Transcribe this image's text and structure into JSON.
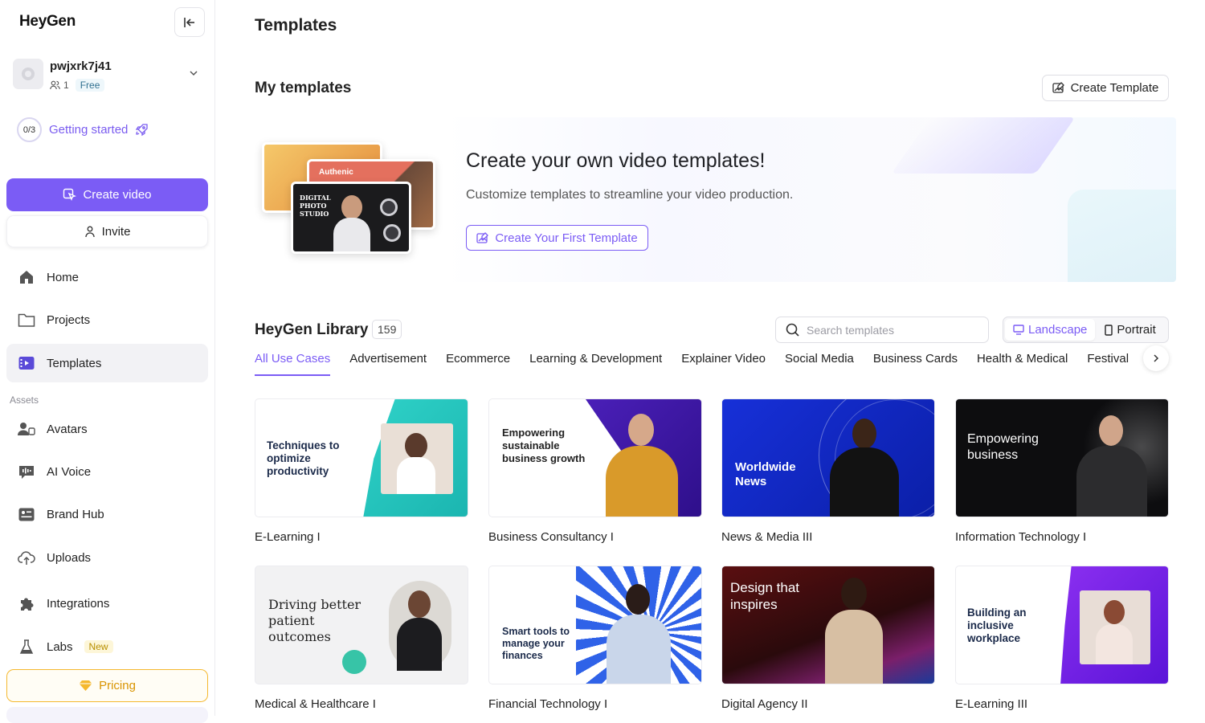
{
  "app": {
    "logo": "HeyGen"
  },
  "sidebar": {
    "account": {
      "name": "pwjxrk7j41",
      "members": "1",
      "plan": "Free"
    },
    "getting_started": {
      "progress": "0/3",
      "label": "Getting started"
    },
    "create_video": "Create video",
    "invite": "Invite",
    "nav": [
      {
        "label": "Home",
        "icon": "home-icon"
      },
      {
        "label": "Projects",
        "icon": "folder-icon"
      },
      {
        "label": "Templates",
        "icon": "templates-icon",
        "active": true
      }
    ],
    "assets_label": "Assets",
    "assets": [
      {
        "label": "Avatars",
        "icon": "avatar-icon"
      },
      {
        "label": "AI Voice",
        "icon": "voice-icon"
      },
      {
        "label": "Brand Hub",
        "icon": "brand-icon"
      },
      {
        "label": "Uploads",
        "icon": "upload-icon"
      },
      {
        "label": "Integrations",
        "icon": "puzzle-icon"
      },
      {
        "label": "Labs",
        "icon": "flask-icon",
        "badge": "New"
      }
    ],
    "pricing": "Pricing"
  },
  "main": {
    "title": "Templates",
    "my_templates": {
      "title": "My templates",
      "create_button": "Create Template",
      "banner": {
        "title": "Create your own video templates!",
        "subtitle": "Customize templates to streamline your video production.",
        "button": "Create Your First Template",
        "card_b_label": "Authenic",
        "card_c_label": "DIGITAL PHOTO STUDIO"
      }
    },
    "library": {
      "title": "HeyGen Library",
      "count": "159",
      "search_placeholder": "Search templates",
      "orientation": {
        "landscape": "Landscape",
        "portrait": "Portrait",
        "selected": "Landscape"
      },
      "tabs": [
        "All Use Cases",
        "Advertisement",
        "Ecommerce",
        "Learning & Development",
        "Explainer Video",
        "Social Media",
        "Business Cards",
        "Health & Medical",
        "Festival"
      ],
      "active_tab": "All Use Cases",
      "templates": [
        {
          "name": "E-Learning I",
          "thumb_text": "Techniques to optimize productivity"
        },
        {
          "name": "Business Consultancy I",
          "thumb_text": "Empowering sustainable business growth"
        },
        {
          "name": "News & Media III",
          "thumb_text": "Worldwide News"
        },
        {
          "name": "Information Technology I",
          "thumb_text": "Empowering business"
        },
        {
          "name": "Medical & Healthcare I",
          "thumb_text": "Driving better patient outcomes"
        },
        {
          "name": "Financial Technology I",
          "thumb_text": "Smart tools to manage your finances"
        },
        {
          "name": "Digital Agency II",
          "thumb_text": "Design that inspires"
        },
        {
          "name": "E-Learning III",
          "thumb_text": "Building an inclusive workplace"
        }
      ]
    }
  },
  "colors": {
    "accent": "#7b5cf5",
    "pricing": "#f5b82e"
  }
}
